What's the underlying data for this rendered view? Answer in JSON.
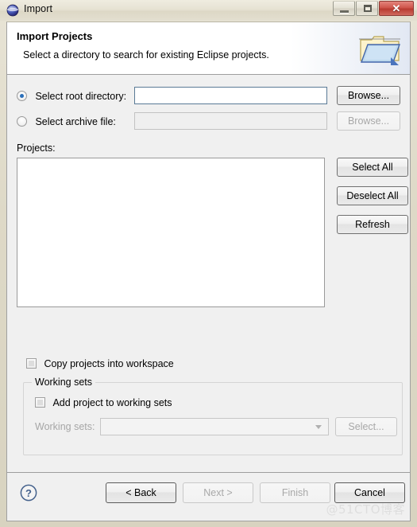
{
  "window": {
    "title": "Import",
    "icon": "eclipse-globe-icon",
    "controls": {
      "minimize": "minimize-button",
      "maximize": "maximize-button",
      "close_glyph": "✕"
    }
  },
  "banner": {
    "title": "Import Projects",
    "description": "Select a directory to search for existing Eclipse projects.",
    "icon": "open-folder-icon"
  },
  "source": {
    "root_directory": {
      "label": "Select root directory:",
      "selected": true,
      "value": "",
      "placeholder": "",
      "browse_label": "Browse...",
      "browse_enabled": true
    },
    "archive_file": {
      "label": "Select archive file:",
      "selected": false,
      "value": "",
      "placeholder": "",
      "browse_label": "Browse...",
      "browse_enabled": false
    }
  },
  "projects": {
    "label": "Projects:",
    "items": [],
    "buttons": {
      "select_all": "Select All",
      "deselect_all": "Deselect All",
      "refresh": "Refresh"
    }
  },
  "options": {
    "copy_projects": {
      "label": "Copy projects into workspace",
      "checked": false
    }
  },
  "working_sets": {
    "group_label": "Working sets",
    "add_checkbox": {
      "label": "Add project to working sets",
      "checked": false
    },
    "combo_label": "Working sets:",
    "combo_value": "",
    "combo_enabled": false,
    "select_button": "Select...",
    "select_enabled": false
  },
  "footer": {
    "help_icon": "help-question-icon",
    "buttons": [
      {
        "label": "< Back",
        "enabled": true,
        "name": "back-button"
      },
      {
        "label": "Next >",
        "enabled": false,
        "name": "next-button"
      },
      {
        "label": "Finish",
        "enabled": false,
        "name": "finish-button"
      },
      {
        "label": "Cancel",
        "enabled": true,
        "name": "cancel-button"
      }
    ],
    "back_label": "< Back",
    "next_label": "Next >",
    "finish_label": "Finish",
    "cancel_label": "Cancel"
  },
  "watermark": "@51CTO博客",
  "colors": {
    "accent": "#2a6fba",
    "dialog_bg": "#f0f0f0",
    "banner_bg": "#ffffff",
    "close_button": "#b83b31",
    "frame": "#ded9c7"
  }
}
